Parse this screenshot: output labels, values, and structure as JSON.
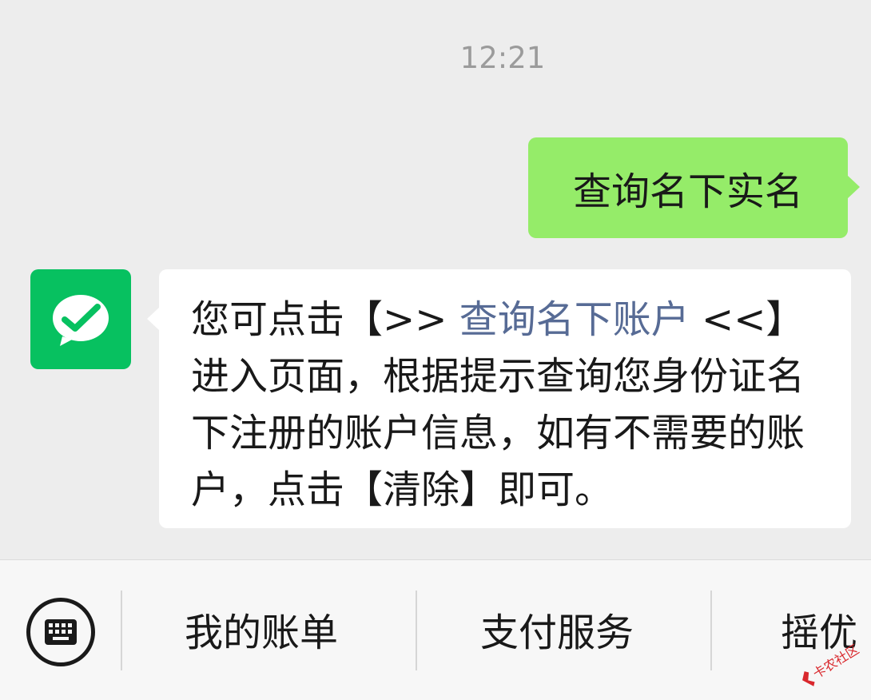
{
  "chat": {
    "timestamp": "12:21",
    "outgoing_message": "查询名下实名",
    "incoming_message": {
      "before_link": "您可点击【>> ",
      "link_text": "查询名下账户",
      "after_link": " <<】进入页面，根据提示查询您身份证名下注册的账户信息，如有不需要的账户，点击【清除】即可。"
    },
    "avatar_icon": "wechat-pay-logo-icon"
  },
  "bottom_menu": {
    "keyboard_icon": "keyboard-icon",
    "items": [
      {
        "label": "我的账单"
      },
      {
        "label": "支付服务"
      },
      {
        "label": "摇优"
      }
    ]
  },
  "watermark": {
    "text": "卡农社区"
  },
  "colors": {
    "chat_background": "#ededed",
    "outgoing_bubble": "#95ec69",
    "incoming_bubble": "#ffffff",
    "link": "#576b95",
    "avatar_green": "#07c160",
    "timestamp": "#9b9b9b"
  }
}
